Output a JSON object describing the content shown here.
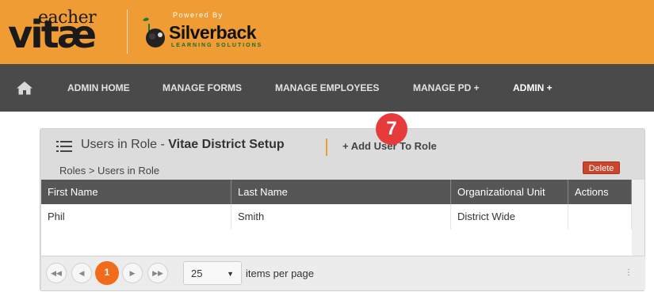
{
  "header": {
    "logo_small": "eacher",
    "logo_big": "vitæ",
    "powered_by": "Powered By",
    "partner_name": "Silverback",
    "partner_sub": "LEARNING SOLUTIONS",
    "bg_color": "#f09c34"
  },
  "nav": {
    "home_icon": "home-icon",
    "items": [
      {
        "label": "ADMIN HOME"
      },
      {
        "label": "MANAGE FORMS"
      },
      {
        "label": "MANAGE EMPLOYEES"
      },
      {
        "label": "MANAGE PD +"
      },
      {
        "label": "ADMIN +"
      }
    ]
  },
  "panel": {
    "title_prefix": "Users in Role - ",
    "title_bold": "Vitae District Setup",
    "add_user_label": "+ Add User To Role",
    "step_badge": "7",
    "breadcrumb": "Roles > Users in Role"
  },
  "table": {
    "columns": [
      "First Name",
      "Last Name",
      "Organizational Unit",
      "Actions"
    ],
    "rows": [
      {
        "first": "Phil",
        "last": "Smith",
        "unit": "District Wide",
        "action": "Delete"
      }
    ]
  },
  "pager": {
    "current_page": "1",
    "page_size": "25",
    "items_label": "items per page",
    "accent_color": "#f26a1b"
  }
}
